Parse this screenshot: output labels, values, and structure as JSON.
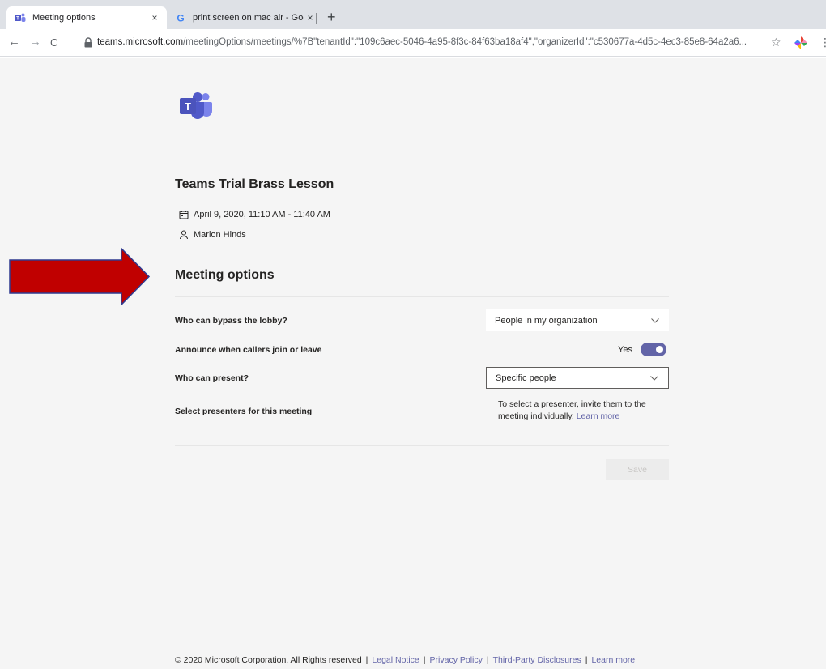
{
  "browser": {
    "tabs": [
      {
        "title": "Meeting options",
        "close": "×",
        "active": true,
        "favicon": "teams-icon"
      },
      {
        "title": "print screen on mac air - Google",
        "close": "×",
        "active": false,
        "favicon": "google-icon"
      }
    ],
    "new_tab": "+",
    "nav": {
      "back": "←",
      "forward": "→",
      "reload": "C"
    },
    "url_host": "teams.microsoft.com",
    "url_path": "/meetingOptions/meetings/%7B\"tenantId\":\"109c6aec-5046-4a95-8f3c-84f63ba18af4\",\"organizerId\":\"c530677a-4d5c-4ec3-85e8-64a2a6...",
    "star": "☆",
    "menu": "⋮"
  },
  "meeting": {
    "title": "Teams Trial Brass Lesson",
    "date": "April 9, 2020, 11:10 AM - 11:40 AM",
    "organizer": "Marion Hinds"
  },
  "options": {
    "section_title": "Meeting options",
    "lobby": {
      "label": "Who can bypass the lobby?",
      "value": "People in my organization"
    },
    "announce": {
      "label": "Announce when callers join or leave",
      "value": "Yes",
      "enabled": true
    },
    "present": {
      "label": "Who can present?",
      "value": "Specific people"
    },
    "presenters": {
      "label": "Select presenters for this meeting",
      "info": "To select a presenter, invite them to the meeting individually.",
      "link": "Learn more"
    },
    "save": "Save"
  },
  "footer": {
    "copyright": "© 2020 Microsoft Corporation. All Rights reserved",
    "sep": "|",
    "links": [
      "Legal Notice",
      "Privacy Policy",
      "Third-Party Disclosures",
      "Learn more"
    ]
  },
  "colors": {
    "teams_purple": "#6264a7",
    "arrow_red": "#c00000",
    "arrow_border": "#2f3a8f"
  }
}
